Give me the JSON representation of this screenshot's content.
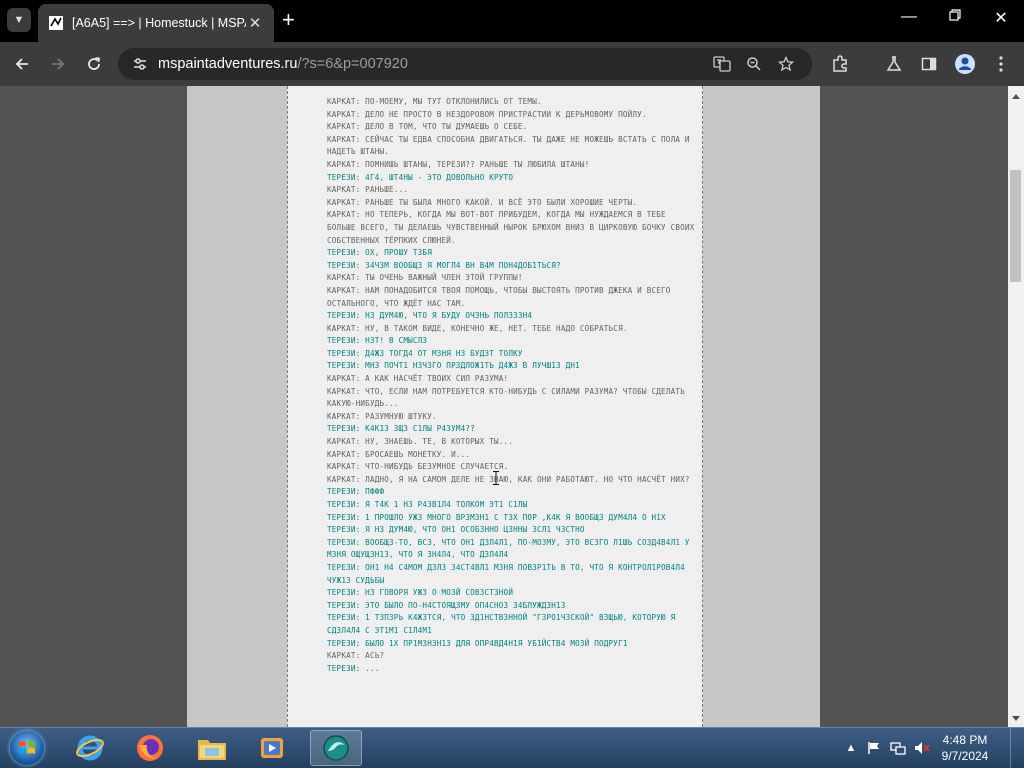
{
  "browser": {
    "tab": {
      "title": "[A6A5] ==> | Homestuck | MSPA"
    },
    "address": {
      "host": "mspaintadventures.ru",
      "path": "/?s=6&p=007920"
    }
  },
  "log": {
    "lines": [
      {
        "speaker": "karkat",
        "text": "КАРКАТ: ПО-МОЕМУ, МЫ ТУТ ОТКЛОНИЛИСЬ ОТ ТЕМЫ."
      },
      {
        "speaker": "karkat",
        "text": "КАРКАТ: ДЕЛО НЕ ПРОСТО В НЕЗДОРОВОМ ПРИСТРАСТИИ К ДЕРЬМОВОМУ ПОЙЛУ."
      },
      {
        "speaker": "karkat",
        "text": "КАРКАТ: ДЕЛО В ТОМ, ЧТО ТЫ ДУМАЕШЬ О СЕБЕ."
      },
      {
        "speaker": "karkat",
        "text": "КАРКАТ: СЕЙЧАС ТЫ ЕДВА СПОСОБНА ДВИГАТЬСЯ. ТЫ ДАЖЕ НЕ МОЖЕШЬ ВСТАТЬ С ПОЛА И НАДЕТЬ ШТАНЫ."
      },
      {
        "speaker": "karkat",
        "text": "КАРКАТ: ПОМНИШЬ ШТАНЫ, ТЕРЕЗИ?? РАНЬШЕ ТЫ ЛЮБИЛА ШТАНЫ!"
      },
      {
        "speaker": "terezi",
        "text": "ТЕРЕЗИ: 4Г4, ШТ4НЫ - ЭТО ДОВОЛЬНО КРУТО"
      },
      {
        "speaker": "karkat",
        "text": "КАРКАТ: РАНЬШЕ..."
      },
      {
        "speaker": "karkat",
        "text": "КАРКАТ: РАНЬШЕ ТЫ БЫЛА МНОГО КАКОЙ. И ВСЁ ЭТО БЫЛИ ХОРОШИЕ ЧЕРТЫ."
      },
      {
        "speaker": "karkat",
        "text": "КАРКАТ: НО ТЕПЕРЬ, КОГДА МЫ ВОТ-ВОТ ПРИБУДЕМ, КОГДА МЫ НУЖДАЕМСЯ В ТЕБЕ БОЛЬШЕ ВСЕГО, ТЫ ДЕЛАЕШЬ ЧУВСТВЕННЫЙ НЫРОК БРЮХОМ ВНИЗ В ЦИРКОВУЮ БОЧКУ СВОИХ СОБСТВЕННЫХ ТЁРПКИХ СЛЮНЕЙ."
      },
      {
        "speaker": "terezi",
        "text": "ТЕРЕЗИ: ОХ, ПРОШУ Т3БЯ"
      },
      {
        "speaker": "terezi",
        "text": "ТЕРЕЗИ: З4Ч3М ВООБЩ3 Я МОГЛ4 ВН В4М ПОН4ДОБ1ТЬСЯ?"
      },
      {
        "speaker": "karkat",
        "text": "КАРКАТ: ТЫ ОЧЕНЬ ВАЖНЫЙ ЧЛЕН ЭТОЙ ГРУППЫ!"
      },
      {
        "speaker": "karkat",
        "text": "КАРКАТ: НАМ ПОНАДОБИТСЯ ТВОЯ ПОМОЩЬ, ЧТОБЫ ВЫСТОЯТЬ ПРОТИВ ДЖЕКА И ВСЕГО ОСТАЛЬНОГО, ЧТО ЖДЁТ НАС ТАМ."
      },
      {
        "speaker": "terezi",
        "text": "ТЕРЕЗИ: Н3 ДУМ4Ю, ЧТО Я БУДУ ОЧ3НЬ ПОЛ3З3Н4"
      },
      {
        "speaker": "karkat",
        "text": "КАРКАТ: НУ, В ТАКОМ ВИДЕ, КОНЕЧНО ЖЕ, НЕТ. ТЕБЕ НАДО СОБРАТЬСЯ."
      },
      {
        "speaker": "terezi",
        "text": "ТЕРЕЗИ: Н3Т! В СМЫСЛ3"
      },
      {
        "speaker": "terezi",
        "text": "ТЕРЕЗИ: Д4Ж3 ТОГД4 ОТ М3НЯ Н3 БУД3Т ТОЛКУ"
      },
      {
        "speaker": "terezi",
        "text": "ТЕРЕЗИ: МН3 ПОЧТ1 Н3Ч3ГО ПР3ДЛОЖ1ТЬ Д4Ж3 В ЛУЧШ13 ДН1"
      },
      {
        "speaker": "karkat",
        "text": "КАРКАТ: А КАК НАСЧЁТ ТВОИХ СИЛ РАЗУМА!"
      },
      {
        "speaker": "karkat",
        "text": "КАРКАТ: ЧТО, ЕСЛИ НАМ ПОТРЕБУЕТСЯ КТО-НИБУДЬ С СИЛАМИ РАЗУМА? ЧТОБЫ СДЕЛАТЬ КАКУЮ-НИБУДЬ..."
      },
      {
        "speaker": "karkat",
        "text": "КАРКАТ: РАЗУМНУЮ ШТУКУ."
      },
      {
        "speaker": "terezi",
        "text": "ТЕРЕЗИ: К4К13 3Щ3 С1ЛЫ Р4ЗУМ4??"
      },
      {
        "speaker": "karkat",
        "text": "КАРКАТ: НУ, ЗНАЕШЬ. ТЕ, В КОТОРЫХ ТЫ..."
      },
      {
        "speaker": "karkat",
        "text": "КАРКАТ: БРОСАЕШЬ МОНЕТКУ. И..."
      },
      {
        "speaker": "karkat",
        "text": "КАРКАТ: ЧТО-НИБУДЬ БЕЗУМНОЕ СЛУЧАЕТСЯ."
      },
      {
        "speaker": "karkat",
        "text": "КАРКАТ: ЛАДНО, Я НА САМОМ ДЕЛЕ НЕ ЗНАЮ, КАК ОНИ РАБОТАЮТ. НО ЧТО НАСЧЁТ НИХ?"
      },
      {
        "speaker": "terezi",
        "text": "ТЕРЕЗИ: ПФФФ"
      },
      {
        "speaker": "terezi",
        "text": "ТЕРЕЗИ: Я Т4К 1 Н3 Р4ЗВ1Л4 ТОЛКОМ ЭТ1 С1ЛЫ"
      },
      {
        "speaker": "terezi",
        "text": "ТЕРЕЗИ: 1 ПРОШЛО УЖ3 МНОГО ВР3М3Н1 С Т3Х ПОР ,К4К Я ВООБЩ3 ДУМ4Л4 О Н1Х"
      },
      {
        "speaker": "terezi",
        "text": "ТЕРЕЗИ: Я Н3 ДУМ4Ю, ЧТО ОН1 ОСОБ3ННО Ц3ННЫ 3СЛ1 Ч3СТНО"
      },
      {
        "speaker": "terezi",
        "text": "ТЕРЕЗИ: ВООБЩ3-ТО, ВС3, ЧТО ОН1 Д3Л4Л1, ПО-МО3МУ, ЭТО ВС3ГО Л1ШЬ СОЗД4В4Л1 У М3НЯ ОЩУЩ3Н13, ЧТО Я ЗН4Л4, ЧТО Д3Л4Л4"
      },
      {
        "speaker": "terezi",
        "text": "ТЕРЕЗИ: ОН1 Н4 С4МОМ Д3Л3 З4СТ4ВЛ1 М3НЯ ПОВ3Р1ТЬ В ТО, ЧТО Я КОНТРОЛ1РОВ4Л4 ЧУЖ13 СУДЬБЫ"
      },
      {
        "speaker": "terezi",
        "text": "ТЕРЕЗИ: Н3 ГОВОРЯ УЖ3 О МО3Й СОВ3СТ3НОЙ"
      },
      {
        "speaker": "terezi",
        "text": "ТЕРЕЗИ: ЭТО БЫЛО ПО-Н4СТОЯЩ3МУ ОП4СНОЗ З4БЛУЖД3Н13"
      },
      {
        "speaker": "terezi",
        "text": "ТЕРЕЗИ: 1 Т3П3РЬ К4Ж3ТСЯ, ЧТО 3Д1НСТВ3ННОЙ \"Г3РО1Ч3СКОЙ\" В3ЩЬЮ, КОТОРУЮ Я СД3Л4Л4 С ЭТ1М1 С1Л4М1"
      },
      {
        "speaker": "terezi",
        "text": "ТЕРЕЗИ: БЫЛО 1Х ПР1М3Н3Н13 ДЛЯ ОПР4ВД4Н1Я УБ1ЙСТВ4 МО3Й ПОДРУГ1"
      },
      {
        "speaker": "karkat",
        "text": "КАРКАТ: АСЬ?"
      },
      {
        "speaker": "terezi",
        "text": "ТЕРЕЗИ: ..."
      }
    ]
  },
  "taskbar": {
    "apps": [
      "internet-explorer",
      "firefox",
      "file-explorer",
      "media-player",
      "active-app"
    ],
    "clock": {
      "time": "4:48 PM",
      "date": "9/7/2024"
    }
  },
  "colors": {
    "karkat": "#626262",
    "terezi": "#008282"
  }
}
